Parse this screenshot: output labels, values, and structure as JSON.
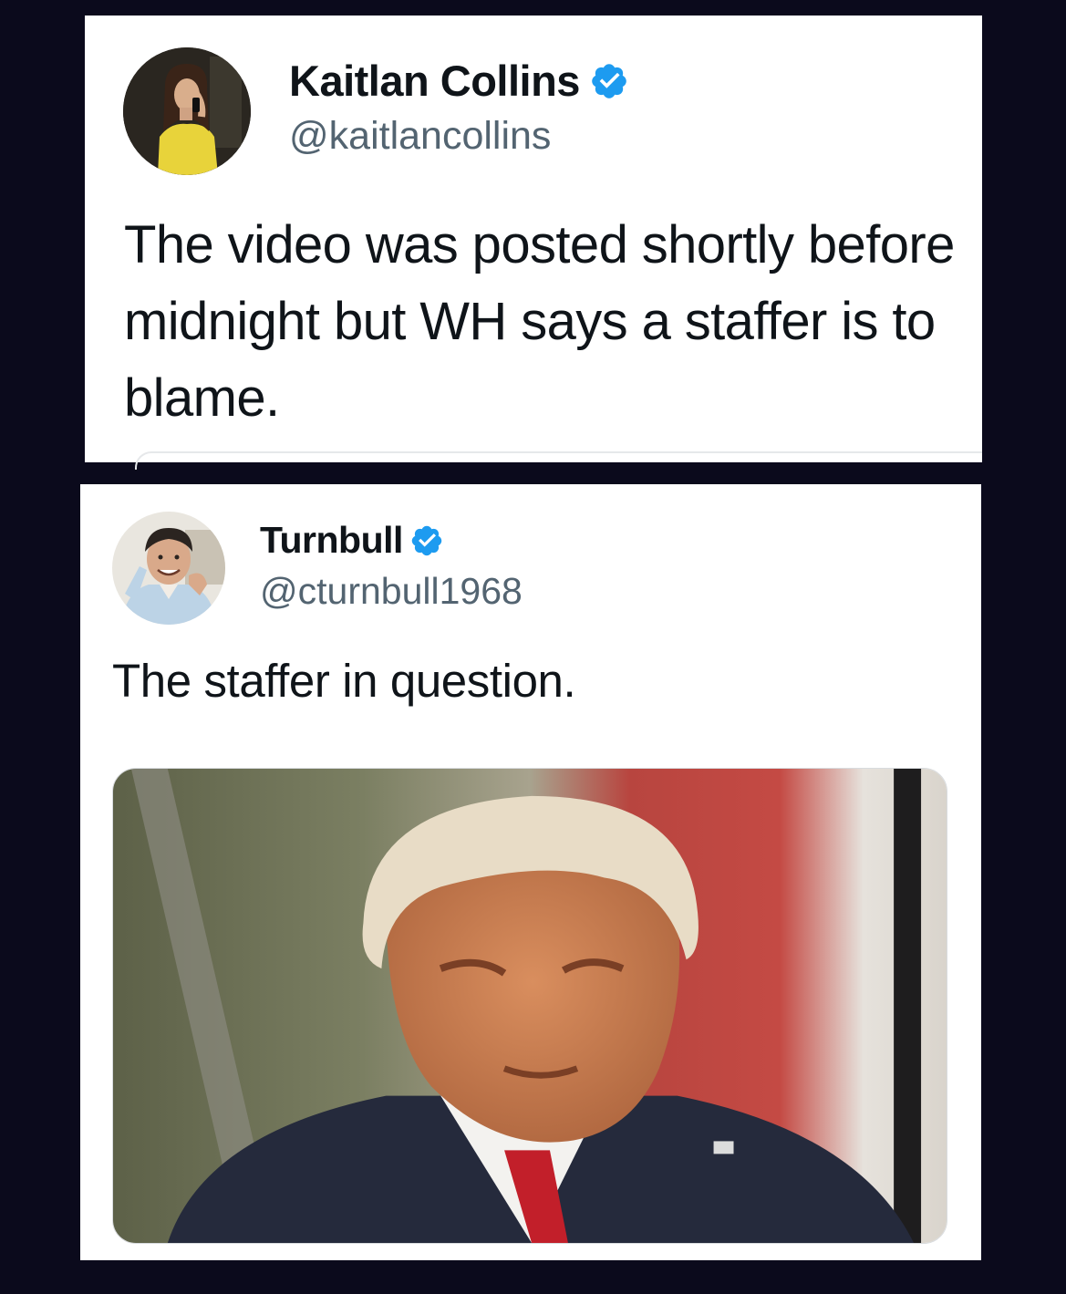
{
  "tweets": [
    {
      "display_name": "Kaitlan Collins",
      "handle": "@kaitlancollins",
      "verified": true,
      "avatar_icon": "profile-photo-avatar",
      "text": "The video was posted shortly before midnight but WH says a staffer is to blame."
    },
    {
      "display_name": "Turnbull",
      "handle": "@cturnbull1968",
      "verified": true,
      "avatar_icon": "cartoon-portrait-avatar",
      "text": "The staffer in question.",
      "media_icon": "attached-photo"
    }
  ],
  "colors": {
    "background": "#0b0a1c",
    "card": "#ffffff",
    "text": "#0f1419",
    "handle": "#536471",
    "verified_badge": "#1d9bf0"
  }
}
